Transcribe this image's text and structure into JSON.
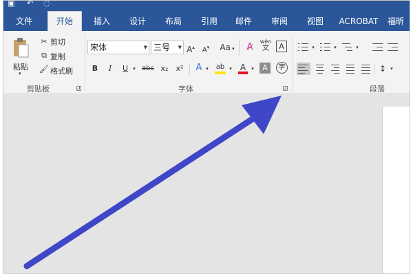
{
  "tabs": [
    {
      "label": "文件",
      "active": false
    },
    {
      "label": "开始",
      "active": true
    },
    {
      "label": "插入",
      "active": false
    },
    {
      "label": "设计",
      "active": false
    },
    {
      "label": "布局",
      "active": false
    },
    {
      "label": "引用",
      "active": false
    },
    {
      "label": "邮件",
      "active": false
    },
    {
      "label": "审阅",
      "active": false
    },
    {
      "label": "视图",
      "active": false
    },
    {
      "label": "ACROBAT",
      "active": false
    },
    {
      "label": "福昕",
      "active": false
    }
  ],
  "clipboard": {
    "paste_label": "粘贴",
    "cut_label": "剪切",
    "copy_label": "复制",
    "format_painter_label": "格式刷",
    "group_label": "剪贴板"
  },
  "font": {
    "font_name": "宋体",
    "font_size": "三号",
    "grow_label": "A",
    "shrink_label": "A",
    "change_case_label": "Aa",
    "phonetic_top": "wén",
    "phonetic_bottom": "文",
    "char_border_label": "A",
    "bold": "B",
    "italic": "I",
    "underline": "U",
    "strikethrough": "abc",
    "subscript": "x₂",
    "superscript": "x²",
    "text_effects": "A",
    "highlight": "ab",
    "font_color": "A",
    "char_shading": "A",
    "enclose_char": "字",
    "group_label": "字体"
  },
  "paragraph": {
    "group_label": "段落"
  },
  "colors": {
    "accent": "#2b579a",
    "arrow": "#3f47c8",
    "highlight": "#ffe600",
    "font_color_bar": "#e81123"
  }
}
